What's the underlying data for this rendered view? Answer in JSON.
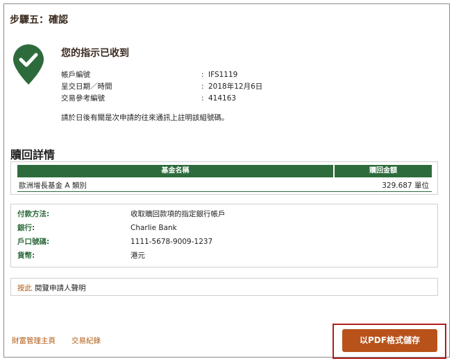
{
  "step_title": "步驟五：確認",
  "confirmation": {
    "title": "您的指示已收到",
    "rows": [
      {
        "label": "帳戶編號",
        "value": "IFS1119"
      },
      {
        "label": "呈交日期／時間",
        "value": "2018年12月6日"
      },
      {
        "label": "交易參考編號",
        "value": "414163"
      }
    ],
    "colon": ":",
    "note": "請於日後有關是次申請的往來通訊上註明該組號碼。"
  },
  "redemption": {
    "section_title": "贖回詳情",
    "headers": [
      "基金名稱",
      "贖回金額"
    ],
    "rows": [
      {
        "fund": "歐洲增長基金 A 類別",
        "amount": "329.687 單位"
      }
    ]
  },
  "payment": [
    {
      "label": "付款方法:",
      "value": "收取贖回款項的指定銀行帳戶"
    },
    {
      "label": "銀行:",
      "value": "Charlie Bank"
    },
    {
      "label": "戶口號碼:",
      "value": "1111-5678-9009-1237"
    },
    {
      "label": "貨幣:",
      "value": "港元"
    }
  ],
  "declaration": {
    "link": "按此",
    "text": "閱覽申請人聲明"
  },
  "footer_links": {
    "home": "財富管理主頁",
    "history": "交易紀錄"
  },
  "pdf_button": "以PDF格式儲存",
  "colors": {
    "accent_green": "#2e6b3c",
    "button": "#b8521a",
    "link": "#b05a12",
    "highlight_border": "#b01c1c"
  },
  "icons": {
    "confirmation": "checkmark-pin-icon"
  }
}
